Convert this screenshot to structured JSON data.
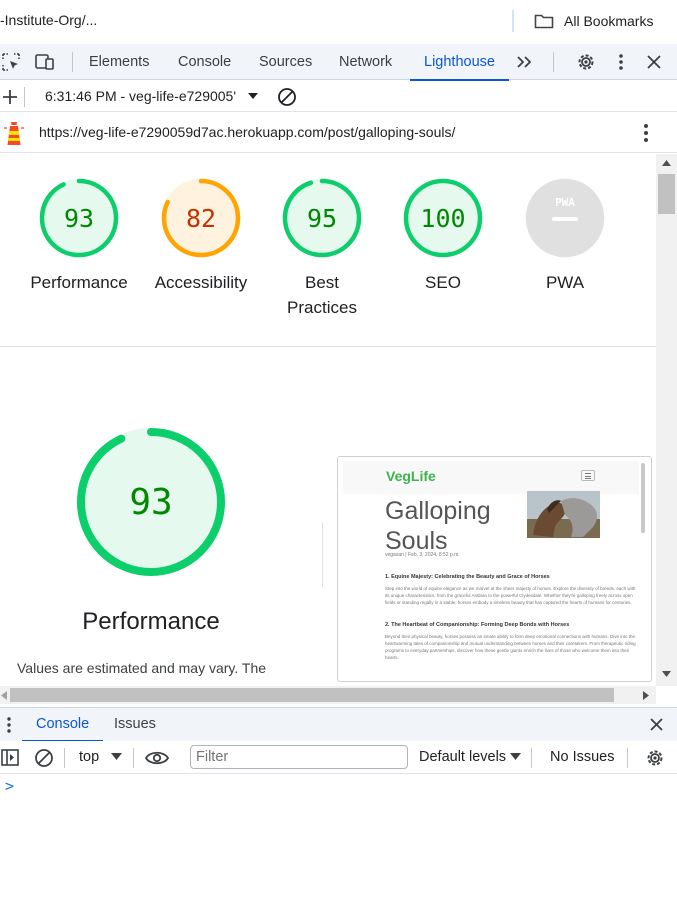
{
  "bookmarks_bar": {
    "left_text": "-Institute-Org/...",
    "all_bookmarks": "All Bookmarks"
  },
  "devtools": {
    "tabs": [
      "Elements",
      "Console",
      "Sources",
      "Network",
      "Lighthouse"
    ],
    "active_tab": "Lighthouse",
    "accent": "#0b57d0"
  },
  "report_bar": {
    "report_label": "6:31:46 PM - veg-life-e729005'"
  },
  "url_bar": {
    "url": "https://veg-life-e7290059d7ac.herokuapp.com/post/galloping-souls/"
  },
  "scores": [
    {
      "label": "Performance",
      "value": 93,
      "display": "93",
      "color": "#0cce6b",
      "text_color": "#008800",
      "bg": "#e5f9ee"
    },
    {
      "label": "Accessibility",
      "value": 82,
      "display": "82",
      "color": "#ffa400",
      "text_color": "#c33300",
      "bg": "#fff3e0"
    },
    {
      "label": "Best",
      "label2": "Practices",
      "value": 95,
      "display": "95",
      "color": "#0cce6b",
      "text_color": "#008800",
      "bg": "#e5f9ee"
    },
    {
      "label": "SEO",
      "value": 100,
      "display": "100",
      "color": "#0cce6b",
      "text_color": "#008800",
      "bg": "#e5f9ee"
    },
    {
      "label": "PWA",
      "value": null,
      "display": "PWA",
      "color": "#cccccc",
      "text_color": "#ffffff",
      "bg": "#e0e0e0"
    }
  ],
  "big_gauge": {
    "value": 93,
    "display": "93",
    "title": "Performance",
    "note": "Values are estimated and may vary. The"
  },
  "thumbnail": {
    "brand": "VegLife",
    "title_line1": "Galloping",
    "title_line2": "Souls",
    "meta": "vegasan | Feb. 3, 2024, 8:52 p.m.",
    "h1": "1. Equine Majesty: Celebrating the Beauty and Grace of Horses",
    "p1": "Step into the world of equine elegance as we marvel at the sheer majesty of horses. Explore the diversity of breeds, each with its unique characteristics, from the graceful Arabian to the powerful Clydesdale. Whether they're galloping freely across open fields or standing regally in a stable, horses embody a timeless beauty that has captured the hearts of humans for centuries.",
    "h2": "2. The Heartbeat of Companionship: Forming Deep Bonds with Horses",
    "p2": "Beyond their physical beauty, horses possess an innate ability to form deep emotional connections with humans. Dive into the heartwarming tales of companionship and mutual understanding between horses and their caretakers. From therapeutic riding programs to everyday partnerships, discover how these gentle giants enrich the lives of those who welcome them into their hearts."
  },
  "console_drawer": {
    "tabs": [
      "Console",
      "Issues"
    ],
    "active_tab": "Console",
    "context": "top",
    "filter_placeholder": "Filter",
    "levels": "Default levels",
    "issues": "No Issues",
    "prompt": ">"
  }
}
